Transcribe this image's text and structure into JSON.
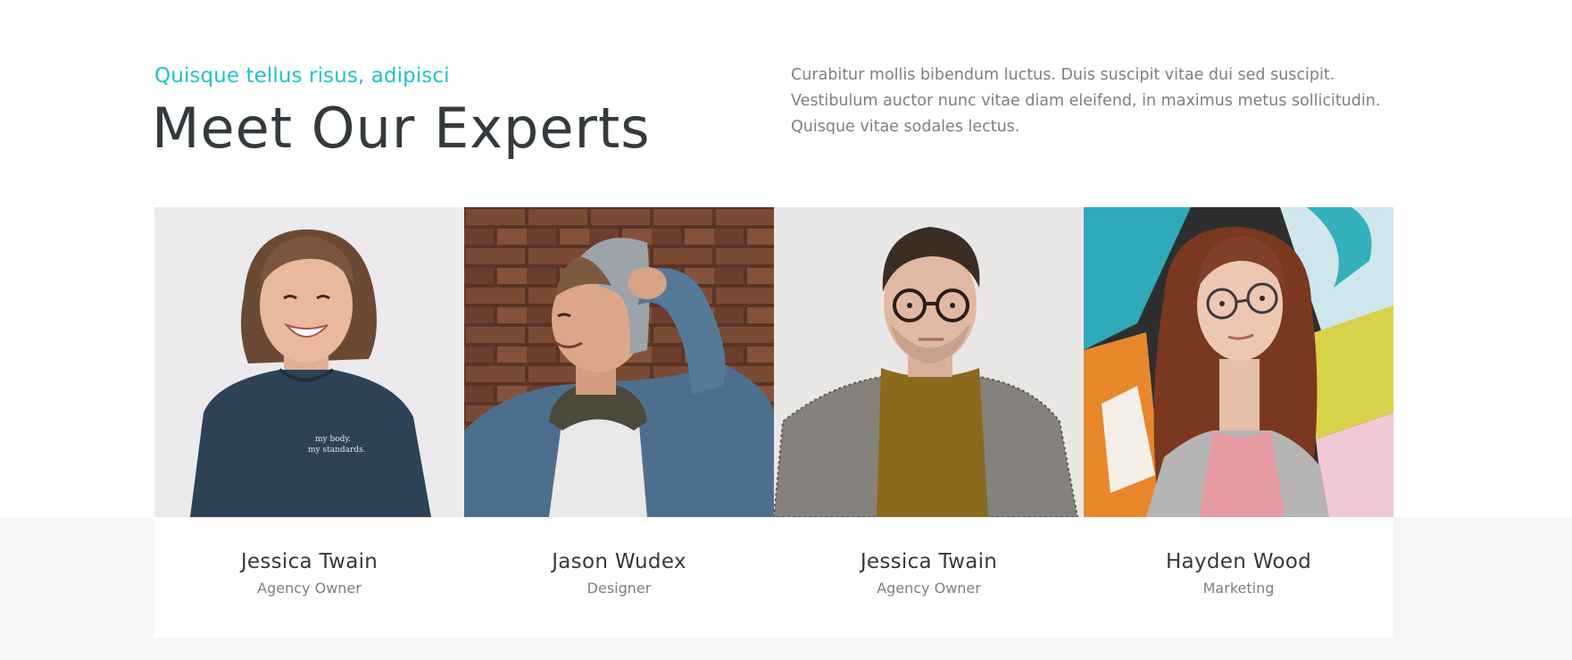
{
  "header": {
    "kicker": "Quisque tellus risus, adipisci",
    "title": "Meet Our Experts",
    "intro": "Curabitur mollis bibendum luctus. Duis suscipit vitae dui sed suscipit. Vestibulum auctor nunc vitae diam eleifend, in maximus metus sollicitudin. Quisque vitae sodales lectus."
  },
  "colors": {
    "accent": "#1ec3c9",
    "heading": "#333a3d",
    "body_text": "#7b7f83",
    "band": "#f5f6f8"
  },
  "team": [
    {
      "name": "Jessica Twain",
      "role": "Agency Owner",
      "photo": "woman-smiling-navy-tshirt",
      "shirt_text": "my body. my standards."
    },
    {
      "name": "Jason Wudex",
      "role": "Designer",
      "photo": "man-beanie-denim-jacket-brick-wall"
    },
    {
      "name": "Jessica Twain",
      "role": "Agency Owner",
      "photo": "man-glasses-turtleneck-blazer"
    },
    {
      "name": "Hayden Wood",
      "role": "Marketing",
      "photo": "woman-glasses-graffiti-wall"
    }
  ]
}
